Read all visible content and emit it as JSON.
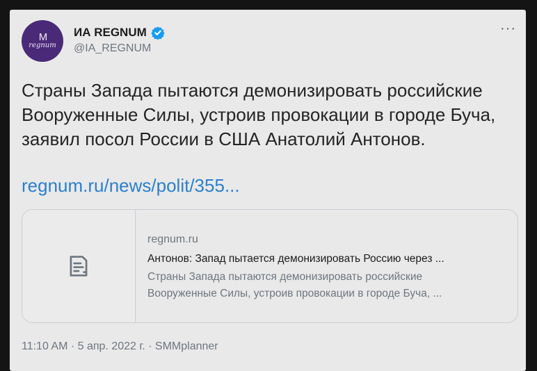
{
  "author": {
    "name": "ИА REGNUM",
    "handle": "@IA_REGNUM",
    "avatar_text": "regnum",
    "avatar_mark": "M",
    "verified_icon": "verified-badge-icon",
    "verified_color": "#1d9bf0"
  },
  "more_label": "···",
  "tweet": {
    "text": "Страны Запада пытаются демонизировать российские Вооруженные Силы, устроив провокации в городе Буча, заявил посол России в США Анатолий Антонов.",
    "link": "regnum.ru/news/polit/355..."
  },
  "card": {
    "icon": "document-icon",
    "domain": "regnum.ru",
    "title": "Антонов: Запад пытается демонизировать Россию через ...",
    "description_line1": "Страны Запада пытаются демонизировать российские",
    "description_line2": "Вооруженные Силы, устроив провокации в городе Буча, ..."
  },
  "meta": {
    "time": "11:10 AM",
    "sep1": " · ",
    "date": "5 апр. 2022 г.",
    "sep2": " · ",
    "app": "SMMplanner"
  },
  "colors": {
    "link": "#2a7fcf",
    "avatar_bg": "#4a2a78",
    "background": "#e9e9e9"
  }
}
